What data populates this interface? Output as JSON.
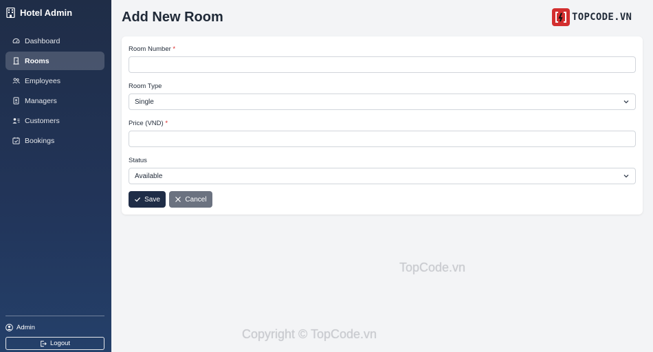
{
  "sidebar": {
    "brand": "Hotel Admin",
    "items": [
      {
        "label": "Dashboard",
        "icon": "speedometer-icon"
      },
      {
        "label": "Rooms",
        "icon": "door-icon",
        "active": true
      },
      {
        "label": "Employees",
        "icon": "people-icon"
      },
      {
        "label": "Managers",
        "icon": "badge-icon"
      },
      {
        "label": "Customers",
        "icon": "person-lines-icon"
      },
      {
        "label": "Bookings",
        "icon": "calendar-check-icon"
      }
    ],
    "user": "Admin",
    "logout": "Logout"
  },
  "page": {
    "title": "Add New Room"
  },
  "logo": {
    "text": "TOPCODE.VN"
  },
  "form": {
    "room_number": {
      "label": "Room Number",
      "required": "*",
      "value": ""
    },
    "room_type": {
      "label": "Room Type",
      "value": "Single"
    },
    "price": {
      "label": "Price (VND)",
      "required": "*",
      "value": ""
    },
    "status": {
      "label": "Status",
      "value": "Available"
    },
    "save": "Save",
    "cancel": "Cancel"
  },
  "watermarks": {
    "center": "TopCode.vn",
    "bottom": "Copyright © TopCode.vn"
  },
  "colors": {
    "sidebar": "#1f2d47",
    "primary_button": "#1f2d47",
    "cancel_button": "#6b7280",
    "required": "#dc2626",
    "logo_red": "#d32f2f"
  }
}
